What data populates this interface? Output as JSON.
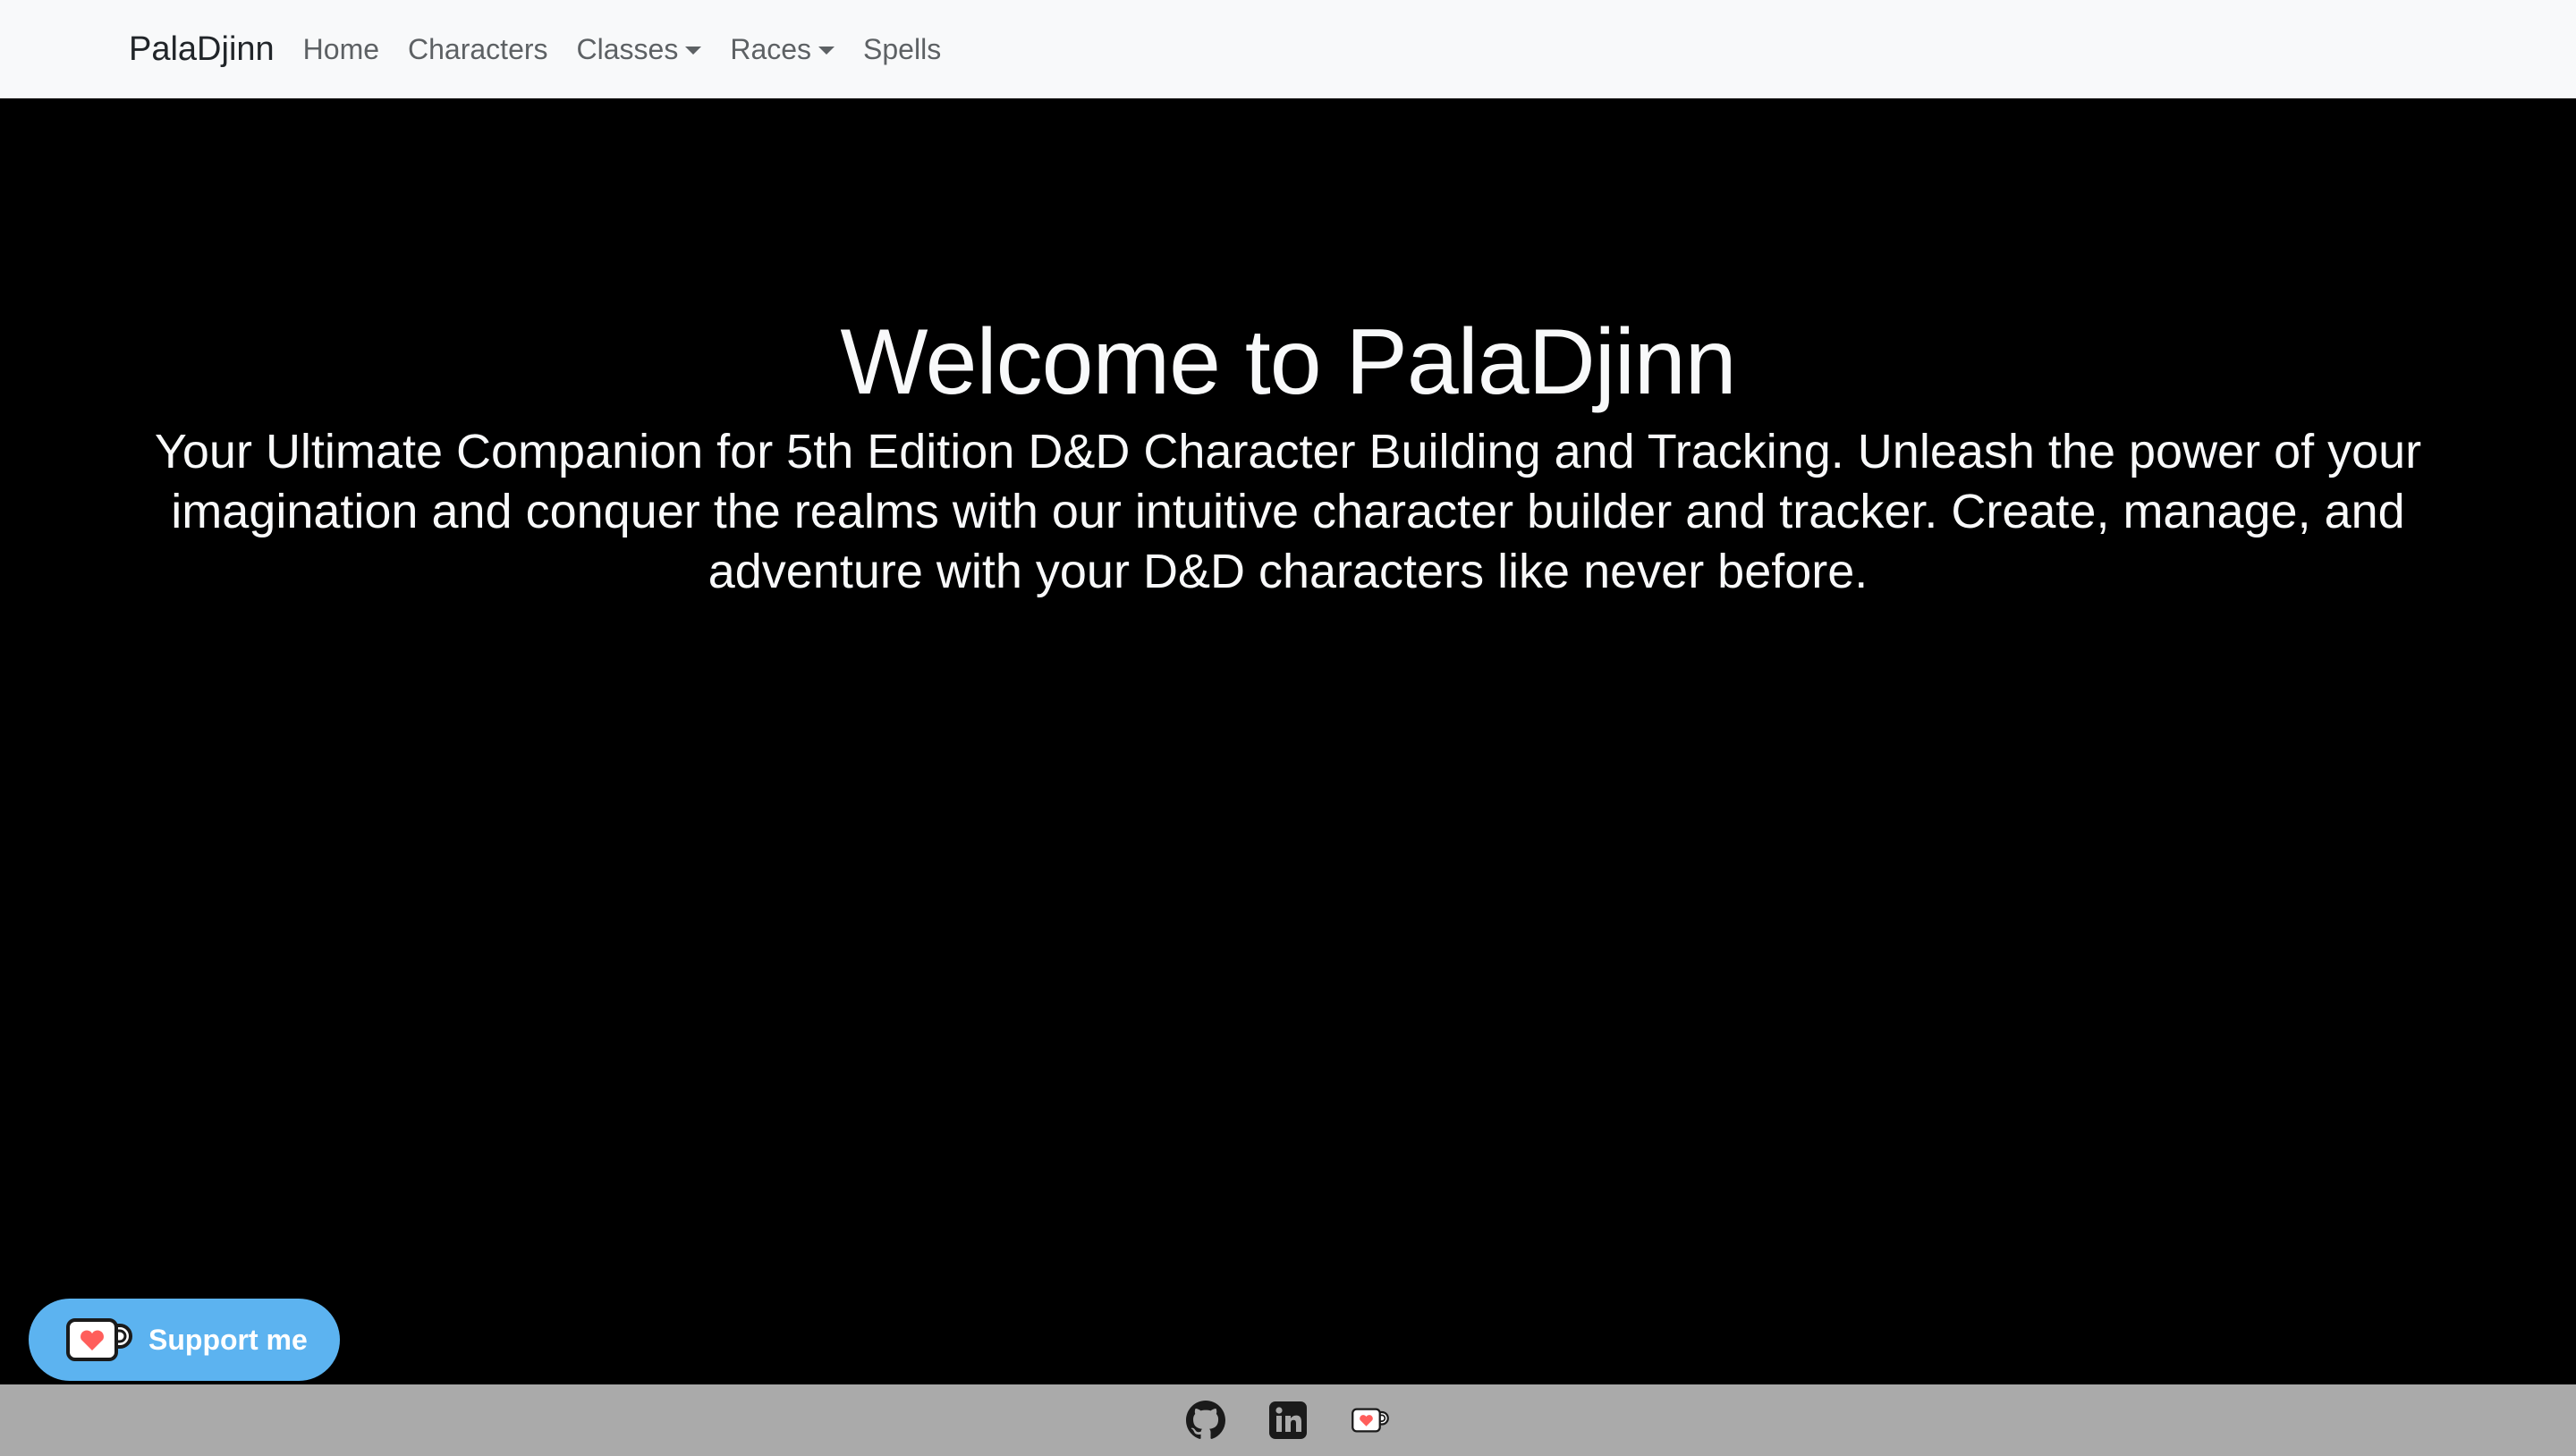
{
  "navbar": {
    "brand": "PalaDjinn",
    "items": [
      {
        "label": "Home",
        "dropdown": false
      },
      {
        "label": "Characters",
        "dropdown": false
      },
      {
        "label": "Classes",
        "dropdown": true
      },
      {
        "label": "Races",
        "dropdown": true
      },
      {
        "label": "Spells",
        "dropdown": false
      }
    ]
  },
  "hero": {
    "title": "Welcome to PalaDjinn",
    "lead": "Your Ultimate Companion for 5th Edition D&D Character Building and Tracking. Unleash the power of your imagination and conquer the realms with our intuitive character builder and tracker. Create, manage, and adventure with your D&D characters like never before."
  },
  "support_button": {
    "label": "Support me",
    "icon": "kofi-cup-icon",
    "color": "#5cb3f0"
  },
  "footer": {
    "icons": [
      "github-icon",
      "linkedin-icon",
      "kofi-icon"
    ],
    "background": "#aaaaaa"
  },
  "colors": {
    "navbar_bg": "#f8f9fa",
    "hero_bg": "#000000",
    "hero_text": "#f8f9fa",
    "heart": "#ff5e5b"
  }
}
